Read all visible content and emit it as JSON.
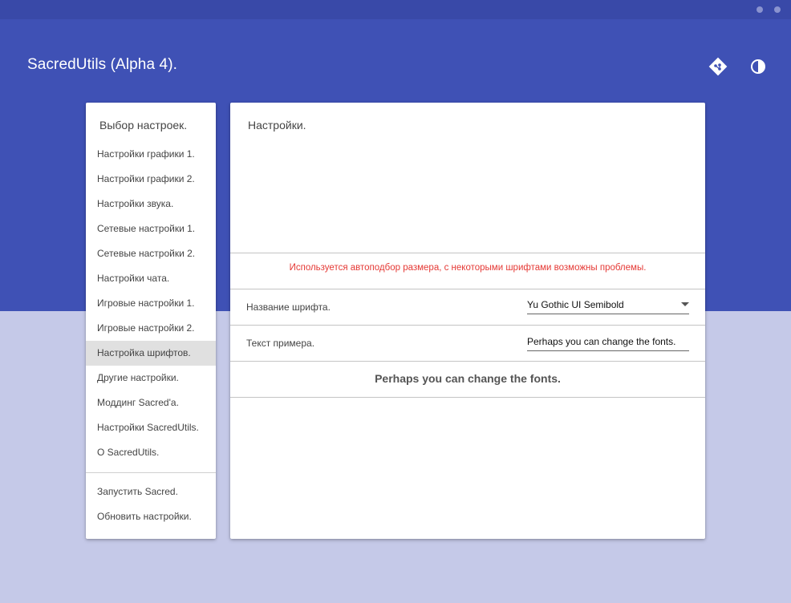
{
  "window": {
    "title": "SacredUtils (Alpha 4)."
  },
  "header": {
    "title": "SacredUtils (Alpha 4).",
    "icons": [
      "git-icon",
      "theme-contrast-icon"
    ]
  },
  "sidebar": {
    "heading": "Выбор настроек.",
    "items": [
      {
        "label": "Настройки графики 1."
      },
      {
        "label": "Настройки графики 2."
      },
      {
        "label": "Настройки звука."
      },
      {
        "label": "Сетевые настройки 1."
      },
      {
        "label": "Сетевые настройки 2."
      },
      {
        "label": "Настройки чата."
      },
      {
        "label": "Игровые настройки 1."
      },
      {
        "label": "Игровые настройки 2."
      },
      {
        "label": "Настройка шрифтов."
      },
      {
        "label": "Другие настройки."
      },
      {
        "label": "Моддинг Sacred'a."
      },
      {
        "label": "Настройки SacredUtils."
      },
      {
        "label": "О SacredUtils."
      }
    ],
    "active_index": 8,
    "actions": [
      {
        "label": "Запустить Sacred."
      },
      {
        "label": "Обновить настройки."
      }
    ]
  },
  "main": {
    "heading": "Настройки.",
    "warning": "Используется автоподбор размера, с некоторыми шрифтами возможны проблемы.",
    "font_name": {
      "label": "Название шрифта.",
      "value": "Yu Gothic UI Semibold"
    },
    "sample_text": {
      "label": "Текст примера.",
      "value": "Perhaps you can change the fonts."
    },
    "preview": "Perhaps you can change the fonts."
  },
  "colors": {
    "primary": "#3f51b5",
    "background": "#c5c9e8",
    "warning": "#e53935"
  }
}
